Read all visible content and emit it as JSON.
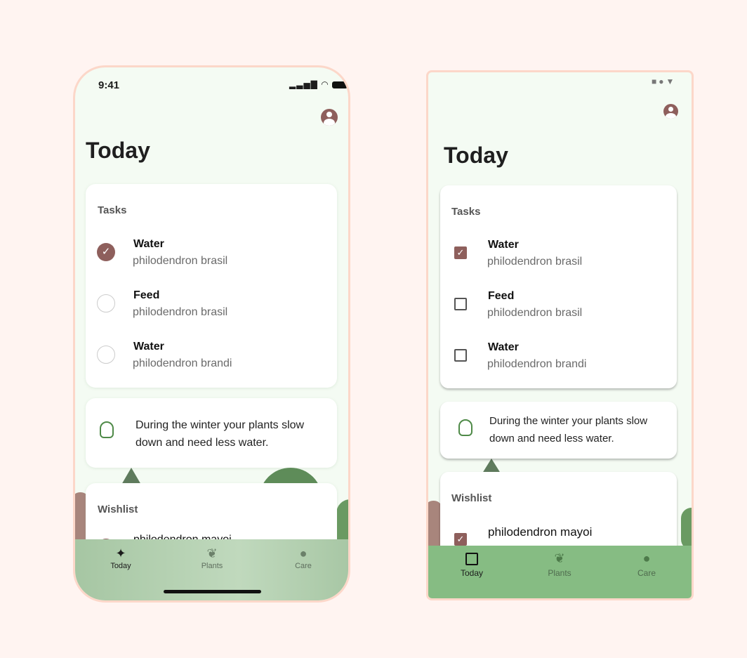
{
  "ios": {
    "status": {
      "time": "9:41"
    },
    "title": "Today",
    "tasks": {
      "heading": "Tasks",
      "items": [
        {
          "name": "Water",
          "plant": "philodendron brasil",
          "done": true
        },
        {
          "name": "Feed",
          "plant": "philodendron brasil",
          "done": false
        },
        {
          "name": "Water",
          "plant": "philodendron brandi",
          "done": false
        }
      ]
    },
    "tip": "During the winter your plants slow down and need less water.",
    "wishlist": {
      "heading": "Wishlist",
      "items": [
        {
          "name": "philodendron mayoi",
          "done": true
        }
      ]
    },
    "tabs": [
      {
        "label": "Today",
        "icon": "sparkle-icon",
        "active": true
      },
      {
        "label": "Plants",
        "icon": "leaf-icon"
      },
      {
        "label": "Care",
        "icon": "lightbulb-icon"
      }
    ]
  },
  "android": {
    "title": "Today",
    "tasks": {
      "heading": "Tasks",
      "items": [
        {
          "name": "Water",
          "plant": "philodendron brasil",
          "done": true
        },
        {
          "name": "Feed",
          "plant": "philodendron brasil",
          "done": false
        },
        {
          "name": "Water",
          "plant": "philodendron brandi",
          "done": false
        }
      ]
    },
    "tip": "During the winter your plants slow down and need less water.",
    "wishlist": {
      "heading": "Wishlist",
      "items": [
        {
          "name": "philodendron mayoi",
          "done": true
        }
      ]
    },
    "tabs": [
      {
        "label": "Today",
        "icon": "calendar-icon",
        "active": true
      },
      {
        "label": "Plants",
        "icon": "leaf-icon"
      },
      {
        "label": "Care",
        "icon": "lightbulb-icon"
      }
    ]
  },
  "colors": {
    "accent": "#8e5f5c",
    "green": "#4f8a48",
    "navAndroid": "#86bc83",
    "navIos": "#b5d1b3",
    "frame": "#fcd7c9"
  }
}
